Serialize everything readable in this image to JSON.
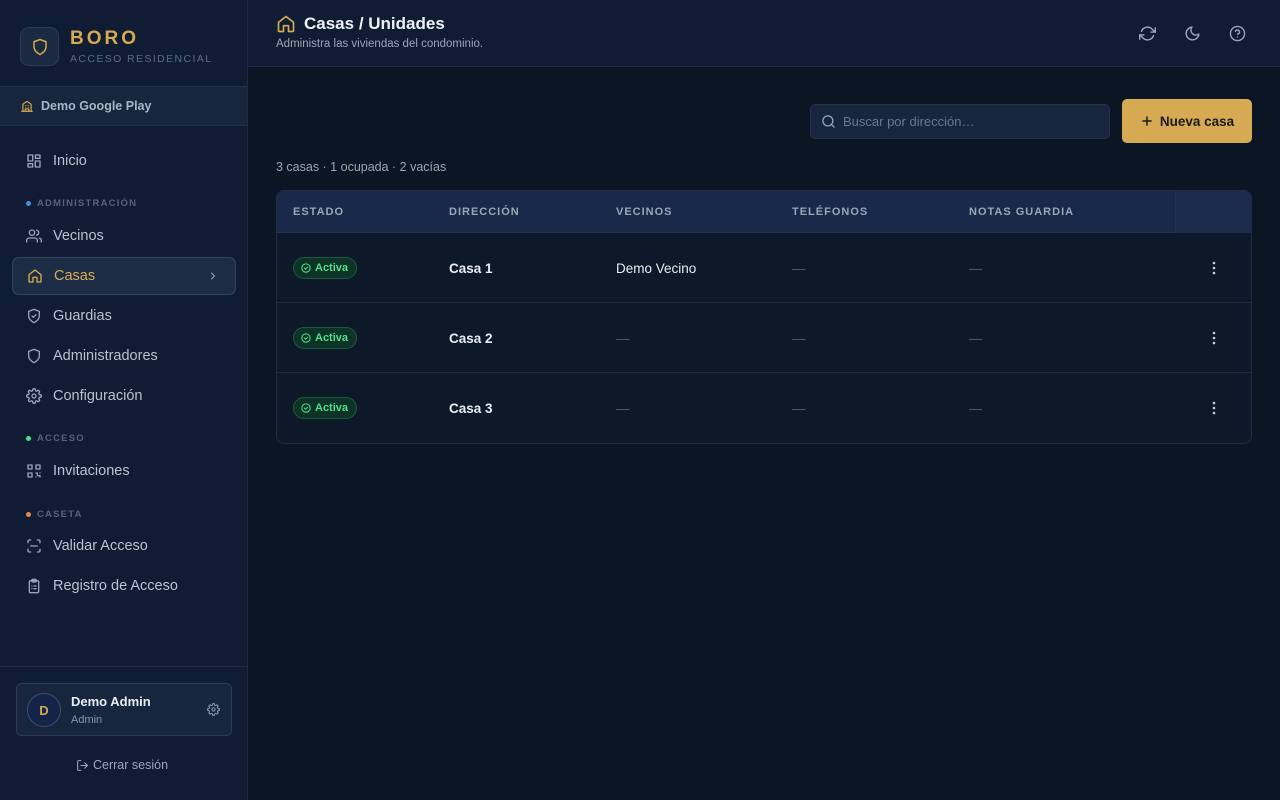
{
  "brand": {
    "name": "BORO",
    "subtitle": "ACCESO RESIDENCIAL"
  },
  "org": {
    "label": "Demo Google Play"
  },
  "nav": {
    "inicio": "Inicio",
    "sections": {
      "admin": "ADMINISTRACIÓN",
      "acceso": "ACCESO",
      "caseta": "CASETA"
    },
    "vecinos": "Vecinos",
    "casas": "Casas",
    "guardias": "Guardias",
    "administradores": "Administradores",
    "configuracion": "Configuración",
    "invitaciones": "Invitaciones",
    "validar": "Validar Acceso",
    "registro": "Registro de Acceso"
  },
  "user": {
    "initial": "D",
    "name": "Demo Admin",
    "role": "Admin",
    "logout": "Cerrar sesión"
  },
  "header": {
    "title": "Casas / Unidades",
    "subtitle": "Administra las viviendas del condominio."
  },
  "search": {
    "placeholder": "Buscar por dirección…"
  },
  "actions": {
    "new_label": "Nueva casa"
  },
  "summary": "3 casas · 1 ocupada · 2 vacías",
  "table": {
    "headers": {
      "estado": "ESTADO",
      "direccion": "DIRECCIÓN",
      "vecinos": "VECINOS",
      "telefonos": "TELÉFONOS",
      "notas": "NOTAS GUARDIA"
    },
    "rows": [
      {
        "estado": "Activa",
        "direccion": "Casa 1",
        "vecinos": "Demo Vecino",
        "telefonos": "—",
        "notas": "—"
      },
      {
        "estado": "Activa",
        "direccion": "Casa 2",
        "vecinos": "—",
        "telefonos": "—",
        "notas": "—"
      },
      {
        "estado": "Activa",
        "direccion": "Casa 3",
        "vecinos": "—",
        "telefonos": "—",
        "notas": "—"
      }
    ]
  },
  "colors": {
    "accent": "#d5aa52",
    "active_badge": "#4ee08a",
    "bg": "#0b1625",
    "sidebar": "#0f1c33",
    "dot_admin": "#4a90e2",
    "dot_acceso": "#4ee08a",
    "dot_caseta": "#e8874a"
  },
  "icons": [
    "shield-icon",
    "building-icon",
    "dashboard-icon",
    "users-icon",
    "home-icon",
    "chevron-right-icon",
    "shield-check-icon",
    "shield-icon",
    "gear-icon",
    "qr-code-icon",
    "scan-icon",
    "clipboard-icon",
    "logout-icon",
    "refresh-icon",
    "moon-icon",
    "help-icon",
    "search-icon",
    "plus-icon",
    "check-circle-icon",
    "more-vertical-icon"
  ]
}
